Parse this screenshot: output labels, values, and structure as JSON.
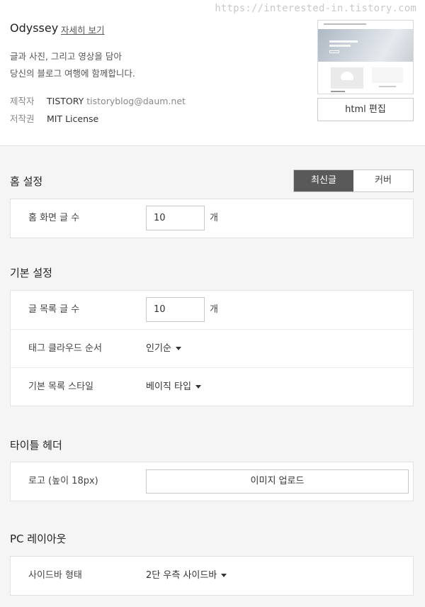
{
  "watermark": "https://interested-in.tistory.com",
  "theme": {
    "name": "Odyssey",
    "detail_link": "자세히 보기",
    "description_line1": "글과 사진, 그리고 영상을 담아",
    "description_line2": "당신의 블로그 여행에 함께합니다.",
    "author_label": "제작자",
    "author_name": "TISTORY",
    "author_email": "tistoryblog@daum.net",
    "license_label": "저작권",
    "license_value": "MIT License",
    "edit_html_button": "html 편집"
  },
  "home_settings": {
    "title": "홈 설정",
    "toggle": {
      "active": "최신글",
      "inactive": "커버"
    },
    "posts_label": "홈 화면 글 수",
    "posts_value": "10",
    "posts_unit": "개"
  },
  "basic_settings": {
    "title": "기본 설정",
    "list_count_label": "글 목록 글 수",
    "list_count_value": "10",
    "list_count_unit": "개",
    "tag_cloud_label": "태그 클라우드 순서",
    "tag_cloud_value": "인기순",
    "list_style_label": "기본 목록 스타일",
    "list_style_value": "베이직 타입"
  },
  "title_header": {
    "title": "타이틀 헤더",
    "logo_label": "로고 (높이 18px)",
    "upload_button": "이미지 업로드"
  },
  "pc_layout": {
    "title": "PC 레이아웃",
    "sidebar_label": "사이드바 형태",
    "sidebar_value": "2단 우측 사이드바"
  }
}
